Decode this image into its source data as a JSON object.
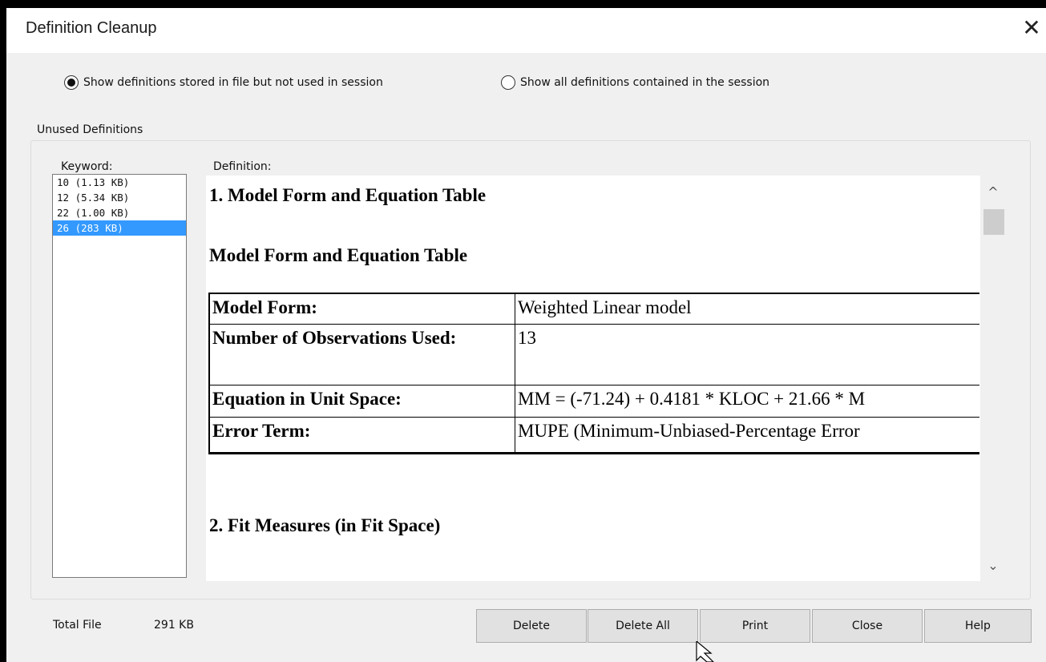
{
  "window": {
    "title": "Definition Cleanup"
  },
  "options": {
    "show_unused_label": "Show definitions stored in file but not used in session",
    "show_unused_checked": true,
    "show_all_label": "Show all definitions contained in the session",
    "show_all_checked": false
  },
  "unused": {
    "group_title": "Unused Definitions",
    "keyword_header": "Keyword:",
    "definition_header": "Definition:",
    "keywords": [
      "10 (1.13 KB)",
      "12 (5.34 KB)",
      "22 (1.00 KB)",
      "26 (283 KB)"
    ],
    "selected_index": 3
  },
  "definition": {
    "heading1": "1. Model Form and Equation Table",
    "heading2": "Model Form and Equation Table",
    "table": [
      {
        "label": "Model Form:",
        "value": "Weighted Linear model"
      },
      {
        "label": "Number of Observations Used:",
        "value": "13"
      },
      {
        "label": "Equation in Unit Space:",
        "value": "MM = (-71.24) + 0.4181 * KLOC + 21.66 * M"
      },
      {
        "label": "Error Term:",
        "value": "MUPE (Minimum-Unbiased-Percentage Error"
      }
    ],
    "heading3": "2. Fit Measures (in Fit Space)"
  },
  "footer": {
    "total_label": "Total File",
    "total_value": "291 KB",
    "buttons": {
      "delete": "Delete",
      "delete_all": "Delete All",
      "print": "Print",
      "close": "Close",
      "help": "Help"
    }
  },
  "icons": {
    "close": "close-icon",
    "scroll_up": "chevron-up-icon",
    "scroll_down": "chevron-down-icon",
    "cursor": "mouse-pointer-icon"
  }
}
